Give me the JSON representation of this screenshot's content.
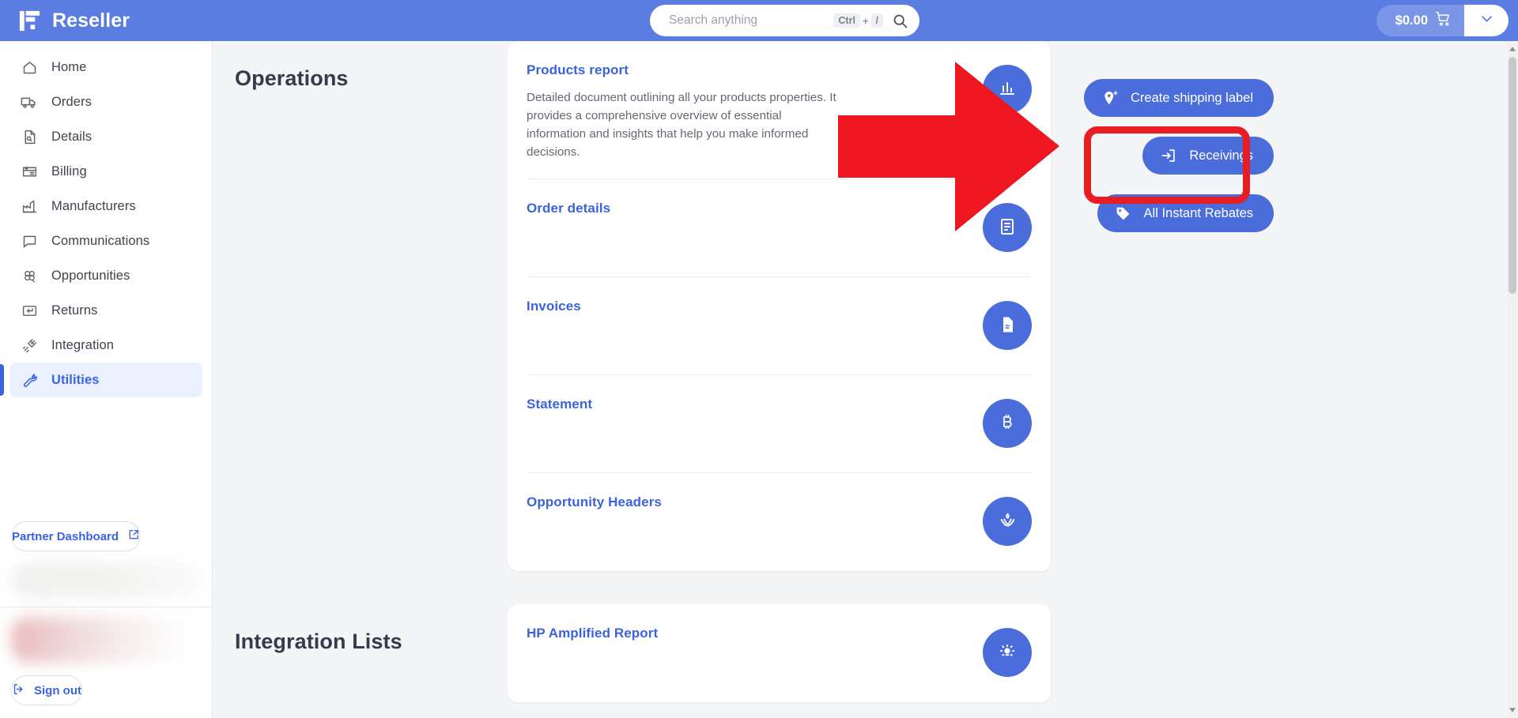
{
  "topbar": {
    "brand_name": "Reseller",
    "brand_logo_icon": "reseller-logo",
    "search": {
      "placeholder": "Search anything",
      "value": "",
      "kbd_key": "Ctrl",
      "kbd_plus": "+",
      "kbd_key2": "/",
      "icon": "search-icon"
    },
    "cart": {
      "amount": "$0.00",
      "icon": "shopping-cart-icon",
      "caret_icon": "chevron-down-icon"
    },
    "accent_color": "#5b7ce0"
  },
  "sidebar": {
    "items": [
      {
        "label": "Home",
        "icon": "home-icon",
        "active": false
      },
      {
        "label": "Orders",
        "icon": "truck-icon",
        "active": false
      },
      {
        "label": "Details",
        "icon": "document-search-icon",
        "active": false
      },
      {
        "label": "Billing",
        "icon": "receipt-icon",
        "active": false
      },
      {
        "label": "Manufacturers",
        "icon": "factory-icon",
        "active": false
      },
      {
        "label": "Communications",
        "icon": "chat-bubble-icon",
        "active": false
      },
      {
        "label": "Opportunities",
        "icon": "clover-icon",
        "active": false
      },
      {
        "label": "Returns",
        "icon": "return-arrow-icon",
        "active": false
      },
      {
        "label": "Integration",
        "icon": "plug-disconnected-icon",
        "active": false
      },
      {
        "label": "Utilities",
        "icon": "wrench-icon",
        "active": true
      }
    ],
    "partner_dashboard": {
      "label": "Partner Dashboard",
      "icon": "external-link-icon"
    },
    "sign_out": {
      "label": "Sign out",
      "icon": "sign-out-icon"
    },
    "active_color": "#3b62df"
  },
  "main": {
    "sections": [
      {
        "title": "Operations",
        "rows": [
          {
            "title": "Products report",
            "desc": "Detailed document outlining all your products properties. It provides a comprehensive overview of essential information and insights that help you make informed decisions.",
            "icon": "chart-report-icon"
          },
          {
            "title": "Order details",
            "desc": "",
            "icon": "order-details-icon"
          },
          {
            "title": "Invoices",
            "desc": "",
            "icon": "invoice-document-icon"
          },
          {
            "title": "Statement",
            "desc": "",
            "icon": "bitcoin-icon"
          },
          {
            "title": "Opportunity Headers",
            "desc": "",
            "icon": "lotus-icon"
          }
        ]
      },
      {
        "title": "Integration Lists",
        "rows": [
          {
            "title": "HP Amplified Report",
            "desc": "",
            "icon": "lightbulb-icon"
          }
        ]
      }
    ]
  },
  "actions": [
    {
      "label": "Create shipping label",
      "icon": "shipping-label-icon",
      "highlighted": false
    },
    {
      "label": "Receivings",
      "icon": "receivings-icon",
      "highlighted": true
    },
    {
      "label": "All Instant Rebates",
      "icon": "tag-icon",
      "highlighted": false
    }
  ],
  "annotation": {
    "arrow_icon": "red-arrow-right",
    "highlight_color": "#e81c23",
    "highlight_target": "Receivings"
  }
}
